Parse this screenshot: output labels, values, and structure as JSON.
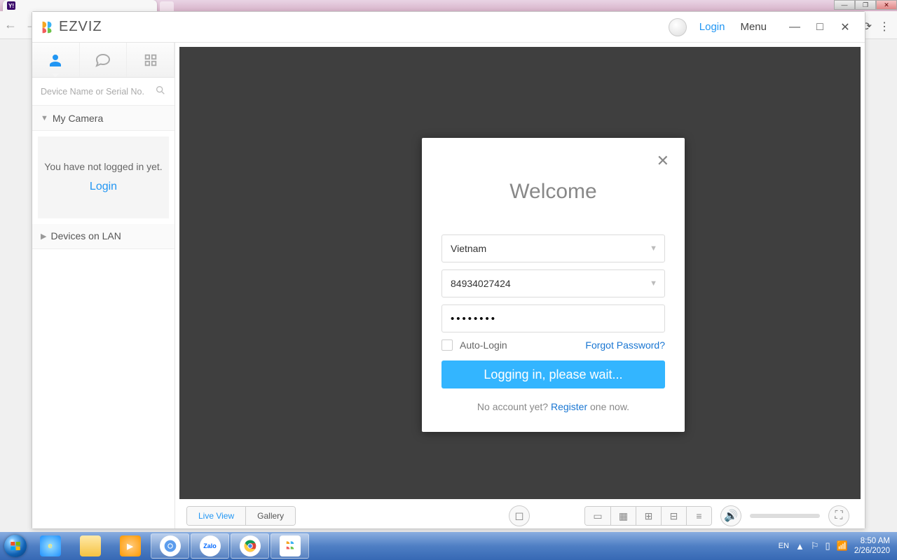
{
  "browser": {
    "win_controls": {
      "min": "—",
      "max": "❐",
      "close": "✕"
    }
  },
  "titlebar": {
    "brand": "EZVIZ",
    "login": "Login",
    "menu": "Menu"
  },
  "sidebar": {
    "search_placeholder": "Device Name or Serial No.",
    "section_my_camera": "My Camera",
    "notice_text": "You have not logged in yet.",
    "notice_login": "Login",
    "section_lan": "Devices on LAN"
  },
  "bottom_toolbar": {
    "tab_live": "Live View",
    "tab_gallery": "Gallery"
  },
  "dialog": {
    "title": "Welcome",
    "country": "Vietnam",
    "username": "84934027424",
    "password_mask": "••••••••",
    "auto_login": "Auto-Login",
    "forgot": "Forgot Password?",
    "login_button": "Logging in, please wait...",
    "no_account_prefix": "No account yet? ",
    "register": "Register",
    "no_account_suffix": " one now."
  },
  "taskbar": {
    "lang": "EN",
    "time": "8:50 AM",
    "date": "2/26/2020"
  }
}
